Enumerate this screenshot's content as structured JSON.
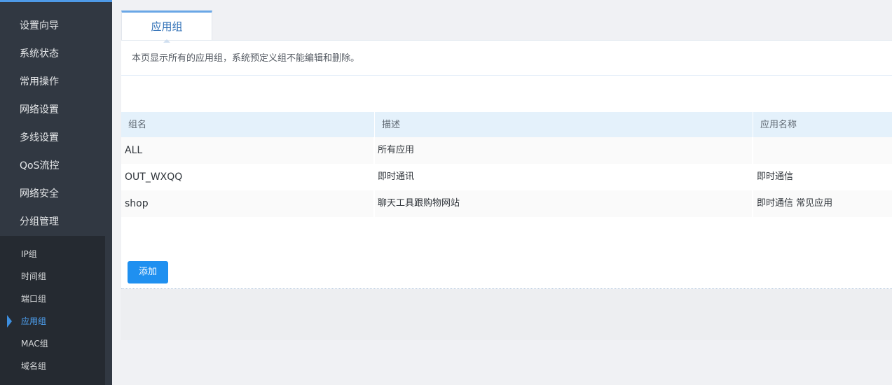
{
  "sidebar": {
    "menu": [
      "设置向导",
      "系统状态",
      "常用操作",
      "网络设置",
      "多线设置",
      "QoS流控",
      "网络安全",
      "分组管理"
    ],
    "submenu": [
      "IP组",
      "时间组",
      "端口组",
      "应用组",
      "MAC组",
      "域名组"
    ],
    "active_submenu": "应用组"
  },
  "tab": {
    "label": "应用组"
  },
  "notice": "本页显示所有的应用组，系统预定义组不能编辑和删除。",
  "table": {
    "headers": [
      "组名",
      "描述",
      "应用名称"
    ],
    "rows": [
      {
        "name": "ALL",
        "desc": "所有应用",
        "apps": ""
      },
      {
        "name": "OUT_WXQQ",
        "desc": "即时通讯",
        "apps": "即时通信"
      },
      {
        "name": "shop",
        "desc": "聊天工具跟购物网站",
        "apps": "即时通信 常见应用"
      }
    ]
  },
  "buttons": {
    "add": "添加"
  },
  "colors": {
    "sidebar": "#313842",
    "submenu_bg": "#252a31",
    "accent": "#1f90f0",
    "table_header": "#e4f1fb"
  }
}
